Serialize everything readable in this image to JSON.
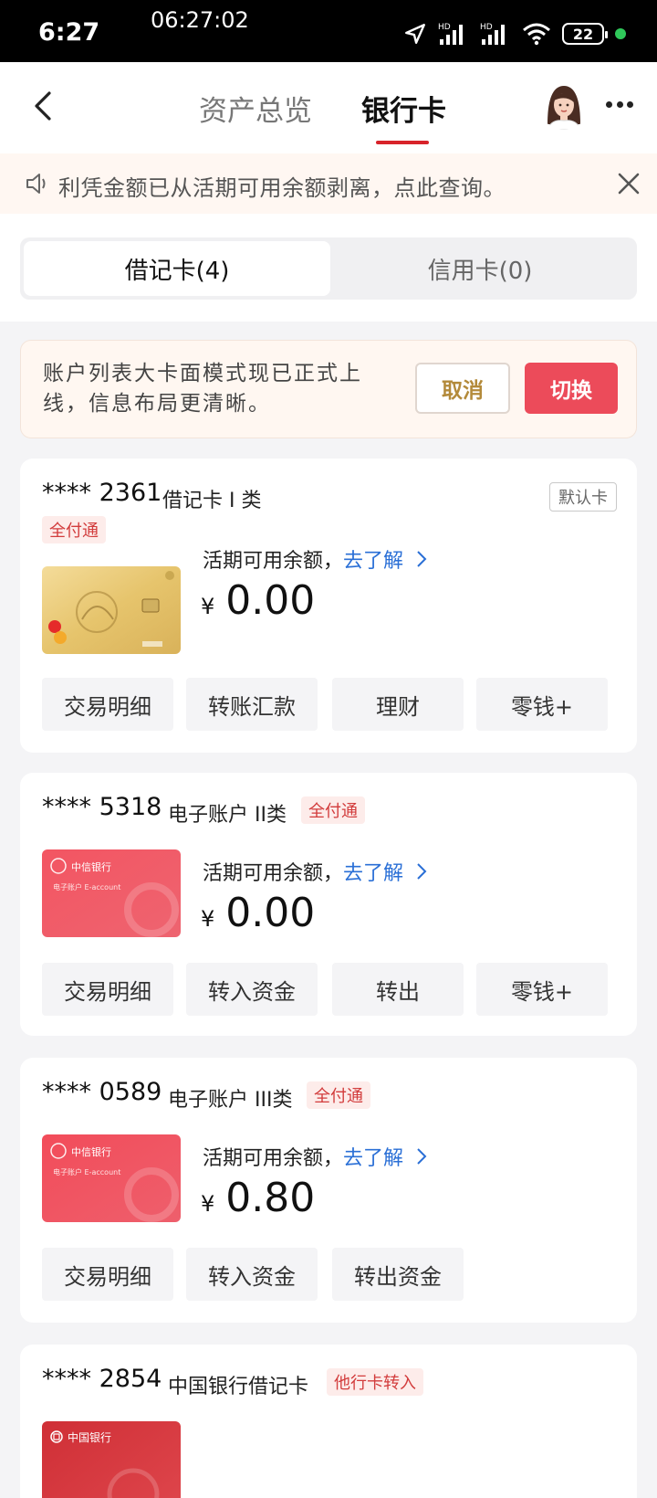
{
  "status_bar": {
    "time": "6:27",
    "clock": "06:27:02",
    "battery": "22",
    "icons": [
      "location-icon",
      "signal-hd-icon",
      "signal-hd-icon",
      "wifi-icon",
      "battery-icon"
    ]
  },
  "header": {
    "tabs": [
      {
        "label": "资产总览",
        "active": false
      },
      {
        "label": "银行卡",
        "active": true
      }
    ],
    "accent": "#d8232a"
  },
  "notice": {
    "text": "利凭金额已从活期可用余额剥离，点此查询。"
  },
  "segment": {
    "debit": "借记卡(4)",
    "credit": "信用卡(0)"
  },
  "promo": {
    "text": "账户列表大卡面模式现已正式上线，信息布局更清晰。",
    "cancel": "取消",
    "switch": "切换"
  },
  "accounts": [
    {
      "number": "**** 2361",
      "type": "借记卡 I 类",
      "tag": "全付通",
      "default_label": "默认卡",
      "balance_label": "活期可用余额，",
      "link": "去了解",
      "currency": "¥",
      "balance": "0.00",
      "actions": [
        "交易明细",
        "转账汇款",
        "理财",
        "零钱+"
      ]
    },
    {
      "number": "**** 5318",
      "type": "电子账户 II类",
      "tag": "全付通",
      "balance_label": "活期可用余额，",
      "link": "去了解",
      "currency": "¥",
      "balance": "0.00",
      "actions": [
        "交易明细",
        "转入资金",
        "转出",
        "零钱+"
      ]
    },
    {
      "number": "**** 0589",
      "type": "电子账户 III类",
      "tag": "全付通",
      "balance_label": "活期可用余额，",
      "link": "去了解",
      "currency": "¥",
      "balance": "0.80",
      "actions": [
        "交易明细",
        "转入资金",
        "转出资金"
      ]
    },
    {
      "number": "**** 2854",
      "type": "中国银行借记卡",
      "tag": "他行卡转入",
      "card_face_text": "中国银行"
    }
  ],
  "card_faces": {
    "citic_bank": "中信银行",
    "citic_sub": "电子账户 E-account"
  }
}
